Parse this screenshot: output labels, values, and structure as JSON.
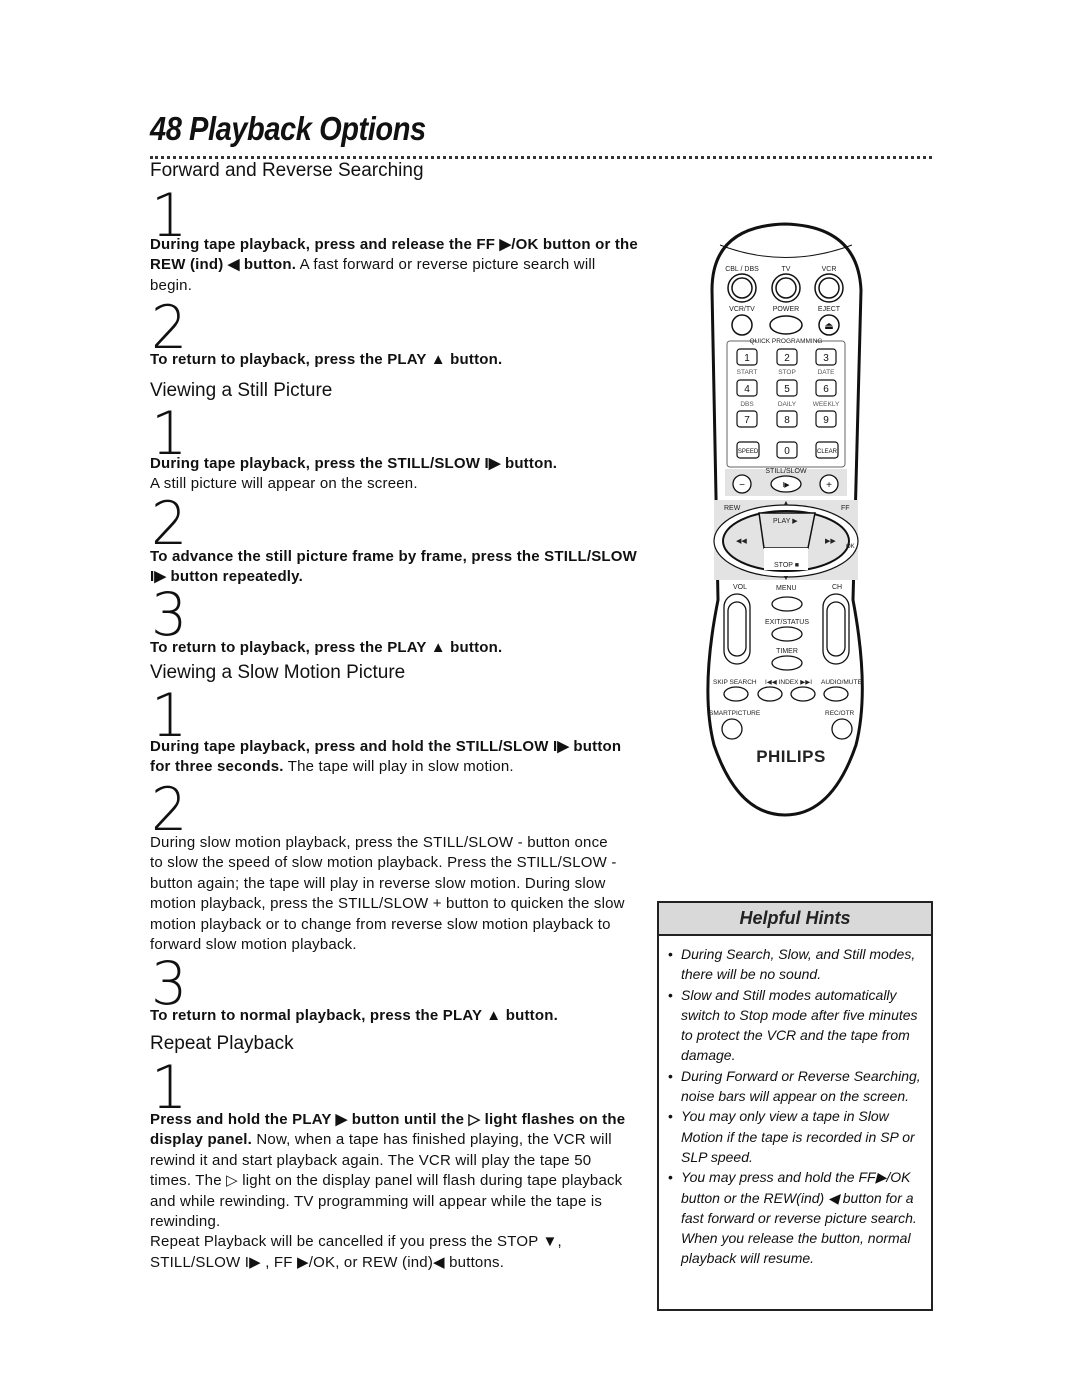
{
  "page": {
    "number_title": "48 Playback Options"
  },
  "forward": {
    "heading": "Forward and Reverse Searching",
    "step1_num": "1",
    "step1_bold": "During tape playback, press and release the FF ▶/OK button or the REW (ind) ◀ button.",
    "step1_text": " A fast forward or reverse picture search will begin.",
    "step2_num": "2",
    "step2_bold": "To return to playback, press the PLAY ▲ button."
  },
  "still": {
    "heading": "Viewing a Still Picture",
    "step1_num": "1",
    "step1_bold": "During tape playback, press the STILL/SLOW I▶ button.",
    "step1_text": "A still picture will appear on the screen.",
    "step2_num": "2",
    "step2_bold": "To advance the still picture frame by frame, press the STILL/SLOW I▶ button repeatedly.",
    "step3_num": "3",
    "step3_bold": "To return to playback, press the PLAY ▲ button."
  },
  "slow": {
    "heading": "Viewing a Slow Motion Picture",
    "step1_num": "1",
    "step1_bold": "During tape playback, press and hold the STILL/SLOW I▶ button for three seconds.",
    "step1_text": " The tape will play in slow motion.",
    "step2_num": "2",
    "step2_text": "During slow motion playback, press the STILL/SLOW - button once to slow the speed of slow motion playback. Press the STILL/SLOW - button again; the tape will play in reverse slow motion. During slow motion playback, press the STILL/SLOW + button to quicken the slow motion playback or to change from reverse slow motion playback to forward slow motion playback.",
    "step3_num": "3",
    "step3_bold": "To return to normal playback, press the PLAY ▲ button."
  },
  "repeat": {
    "heading": "Repeat Playback",
    "step1_num": "1",
    "step1_bold": "Press and hold the PLAY ▶ button until the ▷ light flashes on the display panel.",
    "step1_text": " Now, when a tape has finished playing, the VCR will rewind it and start playback again. The VCR will play the tape 50 times. The ▷ light on the display panel will flash during tape playback and while rewinding. TV programming will appear while the tape is rewinding.",
    "step1_text2": "Repeat Playback will be cancelled if you press the STOP ▼, STILL/SLOW I▶ , FF ▶/OK, or REW (ind)◀ buttons."
  },
  "hints": {
    "title": "Helpful Hints",
    "items": [
      "During Search, Slow, and Still modes, there will be no sound.",
      "Slow and Still modes automatically switch to Stop mode after five minutes to protect the VCR and the tape from damage.",
      "During Forward or Reverse Searching, noise bars will appear on the screen.",
      "You may only view a tape in Slow Motion if the tape is recorded in SP or SLP speed.",
      "You may press and hold the FF▶/OK button or the REW(ind) ◀ button for a fast forward or reverse picture search. When you release the button, normal playback will resume."
    ]
  },
  "remote": {
    "cbl": "CBL / DBS",
    "tv": "TV",
    "vcr": "VCR",
    "vcrtv": "VCR/TV",
    "power": "POWER",
    "eject": "EJECT",
    "eject_icon": "⏏",
    "quick": "QUICK PROGRAMMING",
    "keys": [
      "1",
      "2",
      "3",
      "4",
      "5",
      "6",
      "7",
      "8",
      "9",
      "0"
    ],
    "start": "START",
    "stop_lbl": "STOP",
    "date": "DATE",
    "dbs": "DBS",
    "daily": "DAILY",
    "weekly": "WEEKLY",
    "speed": "SPEED",
    "clear": "CLEAR",
    "still_slow": "STILL/SLOW",
    "minus": "−",
    "plus": "+",
    "still_icon": "I▶",
    "rew": "REW",
    "ff": "FF",
    "play": "PLAY ▶",
    "stop": "STOP ■",
    "ok": "OK",
    "rew_icon": "◀◀",
    "ff_icon": "▶▶",
    "vol": "VOL",
    "menu": "MENU",
    "ch": "CH",
    "exit": "EXIT/STATUS",
    "timer": "TIMER",
    "up": "▲",
    "down": "▼",
    "skip": "SKIP SEARCH",
    "index": "I◀◀ INDEX ▶▶I",
    "audio": "AUDIO/MUTE",
    "smart": "SMARTPICTURE",
    "otr": "REC/OTR",
    "brand": "PHILIPS"
  }
}
